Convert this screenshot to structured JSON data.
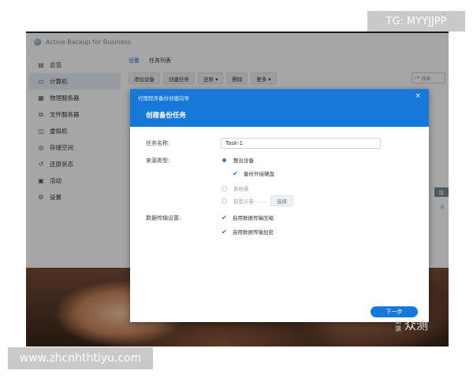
{
  "window": {
    "title": "Active Backup for Business"
  },
  "sidebar": {
    "items": [
      {
        "label": "总览",
        "icon": "overview-icon"
      },
      {
        "label": "计算机",
        "icon": "computer-icon"
      },
      {
        "label": "物理服务器",
        "icon": "server-icon"
      },
      {
        "label": "文件服务器",
        "icon": "file-server-icon"
      },
      {
        "label": "虚拟机",
        "icon": "vm-icon"
      },
      {
        "label": "存储空间",
        "icon": "storage-icon"
      },
      {
        "label": "还原状态",
        "icon": "restore-icon"
      },
      {
        "label": "活动",
        "icon": "activity-icon"
      },
      {
        "label": "设置",
        "icon": "settings-icon"
      }
    ]
  },
  "main": {
    "tabs": [
      "设备",
      "任务列表"
    ],
    "toolbar": [
      "添加设备",
      "创建任务",
      "还原 ▾",
      "删除",
      "更多 ▾"
    ],
    "search_placeholder": "搜索",
    "bg_column_header": "版",
    "bg_column_value": "0"
  },
  "wizard": {
    "top_title": "代理程序备份创建向导",
    "close": "×",
    "title": "创建备份任务",
    "task_name_label": "任务名称:",
    "task_name_value": "Task-1",
    "source_type_label": "来源类型:",
    "opt_whole_device": "整台设备",
    "opt_external_disk": "备份外接硬盘",
    "opt_system_volume": "系统卷",
    "opt_custom_volume": "自定义卷: - - -",
    "select_button": "选择",
    "transfer_label": "数据传输设置:",
    "opt_compression": "启用数据传输压缩",
    "opt_encryption": "启用数据传输加密",
    "next_button": "下一步"
  },
  "watermarks": {
    "top": "TG: MYYJJPP",
    "bottom": "www.zhcnhthtiyu.com",
    "logo_small": "新浪",
    "logo_big": "众测"
  }
}
